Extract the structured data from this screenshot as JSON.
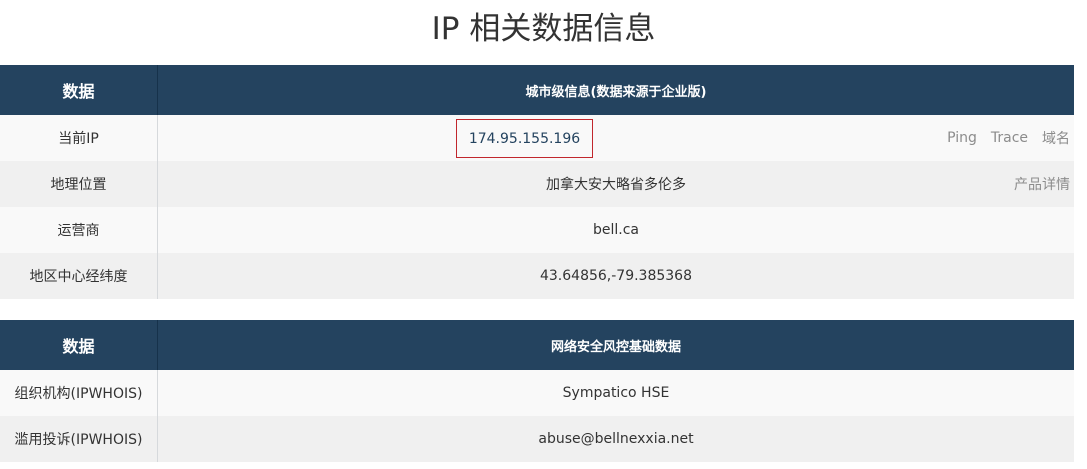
{
  "page_title": "IP 相关数据信息",
  "city_table": {
    "header": {
      "col1": "数据",
      "col2": "城市级信息(数据来源于企业版)"
    },
    "rows": [
      {
        "label": "当前IP",
        "value": "174.95.155.196",
        "links": [
          "Ping",
          "Trace",
          "域名"
        ]
      },
      {
        "label": "地理位置",
        "value": "加拿大安大略省多伦多",
        "links": [
          "产品详情"
        ]
      },
      {
        "label": "运营商",
        "value": "bell.ca"
      },
      {
        "label": "地区中心经纬度",
        "value": "43.64856,-79.385368"
      }
    ]
  },
  "risk_table": {
    "header": {
      "col1": "数据",
      "col2": "网络安全风控基础数据"
    },
    "rows": [
      {
        "label": "组织机构(IPWHOIS)",
        "value": "Sympatico HSE"
      },
      {
        "label": "滥用投诉(IPWHOIS)",
        "value": "abuse@bellnexxia.net"
      }
    ]
  }
}
